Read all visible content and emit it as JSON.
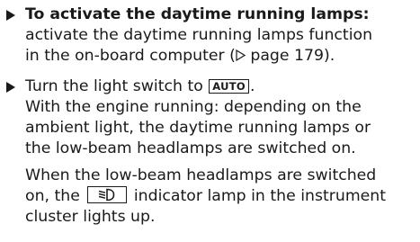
{
  "step1": {
    "heading": "To activate the daytime running lamps:",
    "line1": "activate the daytime running lamps function",
    "line2_prefix": "in the on-board computer (",
    "line2_ref": "page 179",
    "line2_suffix": ")."
  },
  "step2": {
    "line1_prefix": "Turn the light switch to",
    "switch_label": "AUTO",
    "line1_suffix": ".",
    "line2": "With the engine running: depending on the",
    "line3": "ambient light, the daytime running lamps or",
    "line4": "the low-beam headlamps are switched on.",
    "para2_line1": "When the low-beam headlamps are switched",
    "para2_line2_prefix": "on, the",
    "para2_line2_suffix": "indicator lamp in the instrument",
    "para2_line3": "cluster lights up."
  },
  "icons": {
    "bullet": "triangle-bullet-icon",
    "page_ref": "page-reference-triangle-icon",
    "lamp": "low-beam-headlamp-icon"
  }
}
